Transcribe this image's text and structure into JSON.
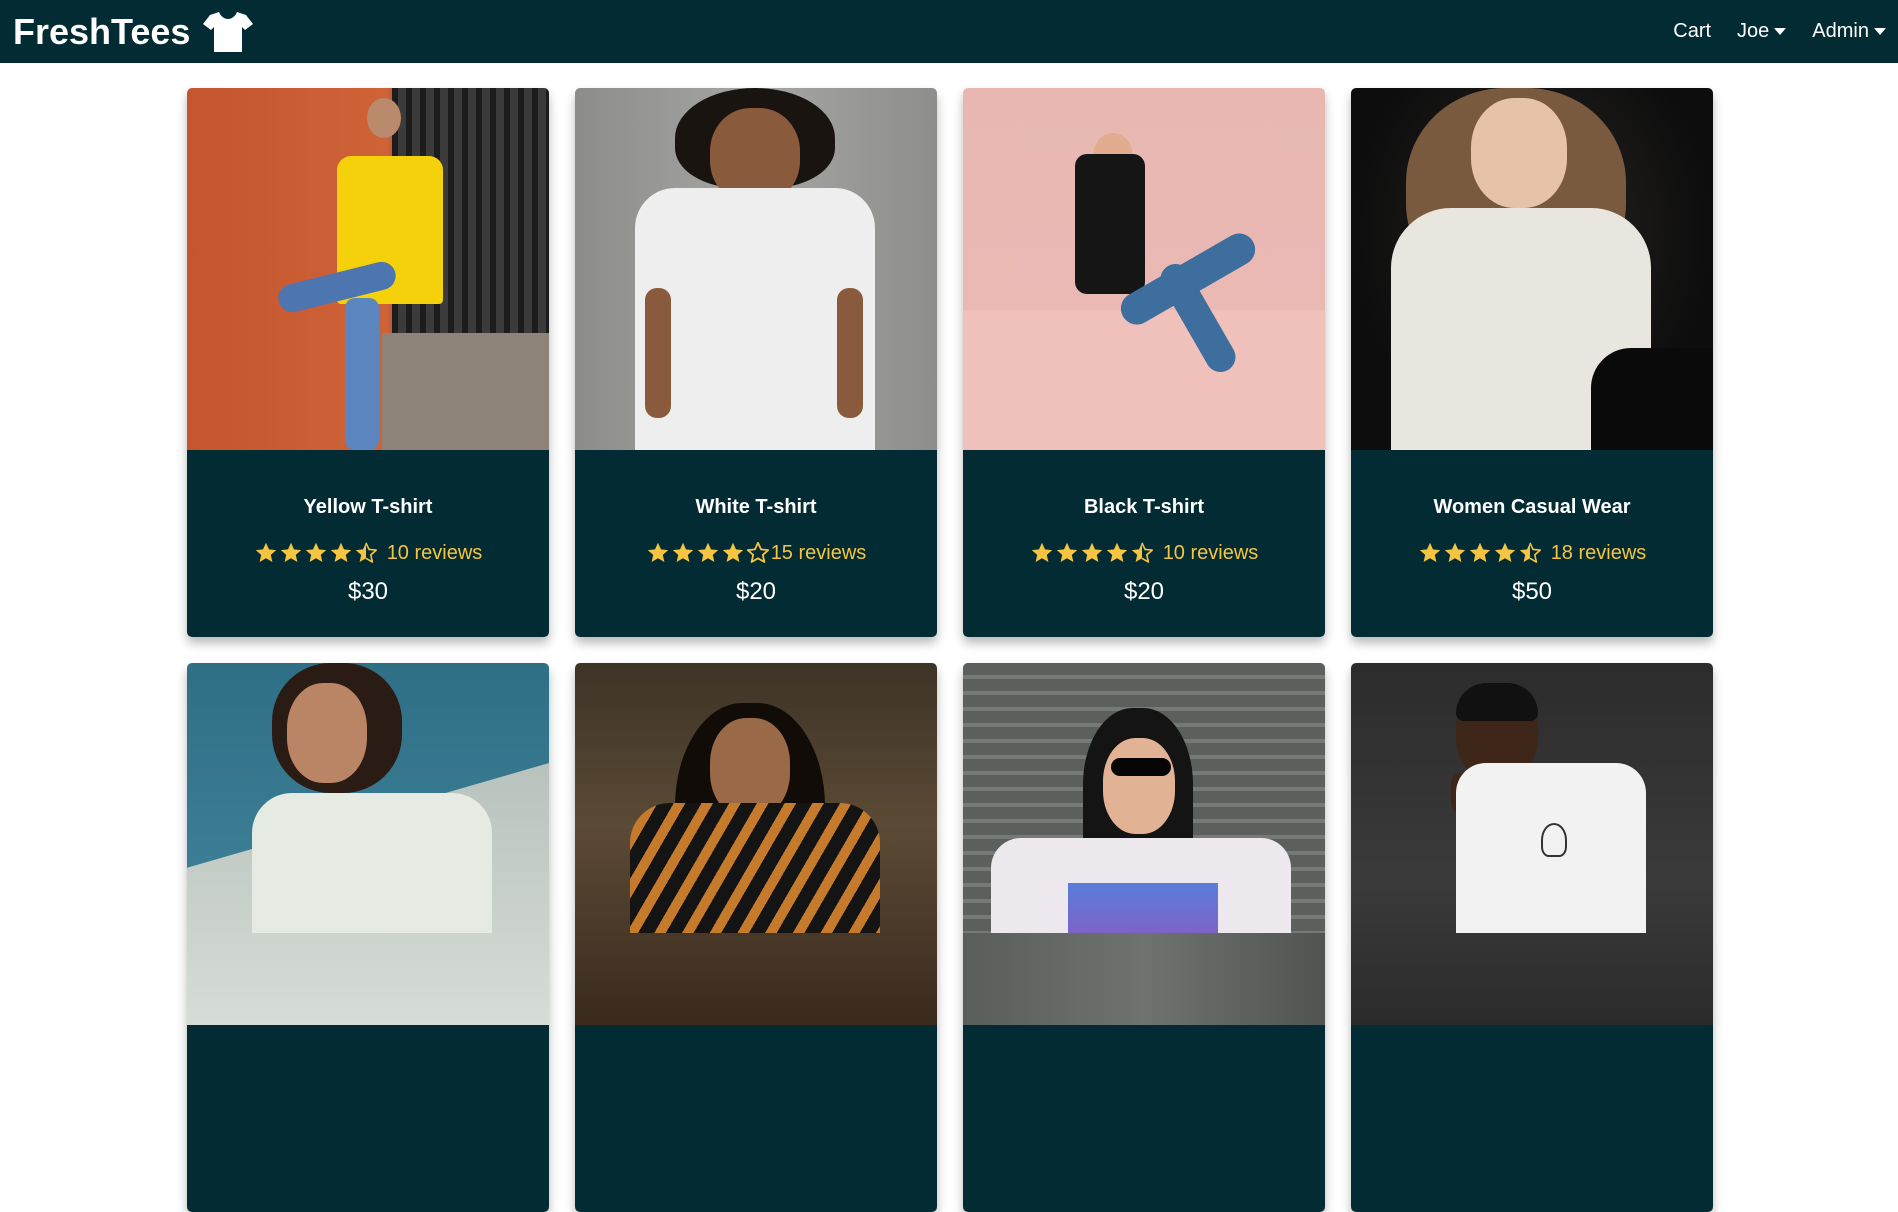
{
  "navbar": {
    "brand": "FreshTees",
    "brand_icon": "tshirt-icon",
    "items": [
      {
        "label": "Cart",
        "dropdown": false
      },
      {
        "label": "Joe",
        "dropdown": true
      },
      {
        "label": "Admin",
        "dropdown": true
      }
    ]
  },
  "colors": {
    "navbar_bg": "#032b33",
    "card_body_bg": "#032b33",
    "star": "#f5c542"
  },
  "products": [
    {
      "name": "Yellow T-shirt",
      "rating": 4.5,
      "reviews": "10 reviews",
      "price": "$30"
    },
    {
      "name": "White T-shirt",
      "rating": 4.0,
      "reviews": "15 reviews",
      "price": "$20"
    },
    {
      "name": "Black T-shirt",
      "rating": 4.5,
      "reviews": "10 reviews",
      "price": "$20"
    },
    {
      "name": "Women Casual Wear",
      "rating": 4.5,
      "reviews": "18 reviews",
      "price": "$50"
    },
    {
      "name": "",
      "rating": null,
      "reviews": "",
      "price": ""
    },
    {
      "name": "",
      "rating": null,
      "reviews": "",
      "price": ""
    },
    {
      "name": "",
      "rating": null,
      "reviews": "",
      "price": ""
    },
    {
      "name": "",
      "rating": null,
      "reviews": "",
      "price": ""
    }
  ]
}
